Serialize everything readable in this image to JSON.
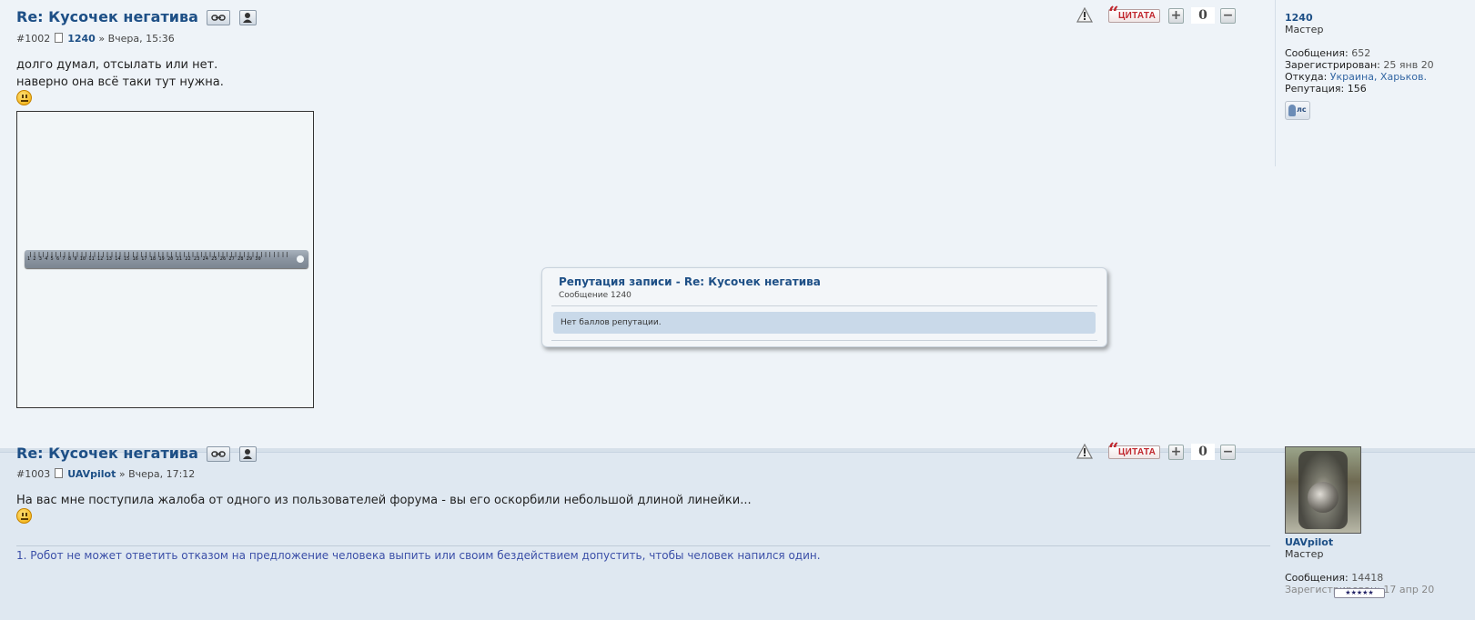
{
  "posts": [
    {
      "title": "Re: Кусочек негатива",
      "number": "#1002",
      "author": "1240",
      "date_sep": "»",
      "date": "Вчера, 15:36",
      "lines": [
        "долго думал, отсылать или нет.",
        "наверно она всё таки тут нужна."
      ],
      "rating": "0",
      "quote_label": "ЦИТАТА",
      "sidebar": {
        "username": "1240",
        "rank": "Мастер",
        "messages_label": "Сообщения:",
        "messages_value": "652",
        "registered_label": "Зарегистрирован:",
        "registered_value": "25 янв 20",
        "from_label": "Откуда:",
        "from_value": "Украина, Харьков.",
        "reputation_label": "Репутация:",
        "reputation_value": "156",
        "pm_label": "лс"
      },
      "ruler_labels": "1 2 3 4 5 6 7 8 9 10 11 12 13 14 15 16 17 18 19 20 21 22 23 24 25 26 27 28 29 30"
    },
    {
      "title": "Re: Кусочек негатива",
      "number": "#1003",
      "author": "UAVpilot",
      "date_sep": "»",
      "date": "Вчера, 17:12",
      "lines": [
        "На вас мне поступила жалоба от одного из пользователей форума - вы его оскорбили небольшой длиной линейки..."
      ],
      "rating": "0",
      "quote_label": "ЦИТАТА",
      "signature": "1. Робот не может ответить отказом на предложение человека выпить или своим бездействием допустить, чтобы человек напился один.",
      "sidebar": {
        "username": "UAVpilot",
        "rank": "Мастер",
        "messages_label": "Сообщения:",
        "messages_value": "14418",
        "registered_label": "Зарегистрирован:",
        "registered_value": "17 апр 20",
        "stars": "★★★★★"
      }
    }
  ],
  "popup": {
    "title": "Репутация записи - Re: Кусочек негатива",
    "subtitle": "Сообщение 1240",
    "message": "Нет баллов репутации."
  },
  "colors": {
    "accent": "#1d4f86",
    "quote": "#c0262d",
    "signature": "#3b4fa8"
  }
}
